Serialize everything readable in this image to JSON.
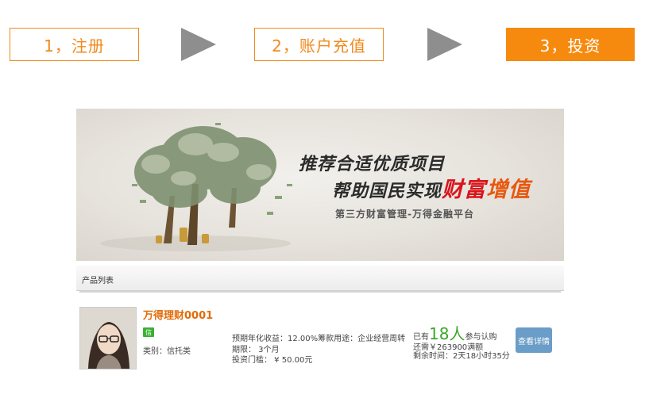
{
  "steps": [
    {
      "label": "1，注册"
    },
    {
      "label": "2，账户充值"
    },
    {
      "label": "3，投资"
    }
  ],
  "colors": {
    "accent": "#f68a0f",
    "arrow": "#8e8e8e",
    "button": "#6a9dc7",
    "green": "#3aa828"
  },
  "banner": {
    "line1": "推荐合适优质项目",
    "line2_prefix": "帮助国民实现",
    "line2_red": "财富",
    "line2_orange": "增值",
    "subtitle": "第三方财富管理-万得金融平台"
  },
  "list": {
    "header": "产品列表",
    "product": {
      "title": "万得理财0001",
      "badge": "信",
      "category": "类别：信托类",
      "info_line1": "预期年化收益：12.00%筹款用途：企业经营周转",
      "info_line2": "期限： 3个月",
      "info_line3": "投资门槛： ¥ 50.00元",
      "participants_prefix": "已有",
      "participants_count": "18人",
      "participants_suffix": "参与认购",
      "remaining": "还需￥263900满额",
      "time_left": "剩余时间：2天18小时35分",
      "detail_button": "查看详情"
    }
  }
}
